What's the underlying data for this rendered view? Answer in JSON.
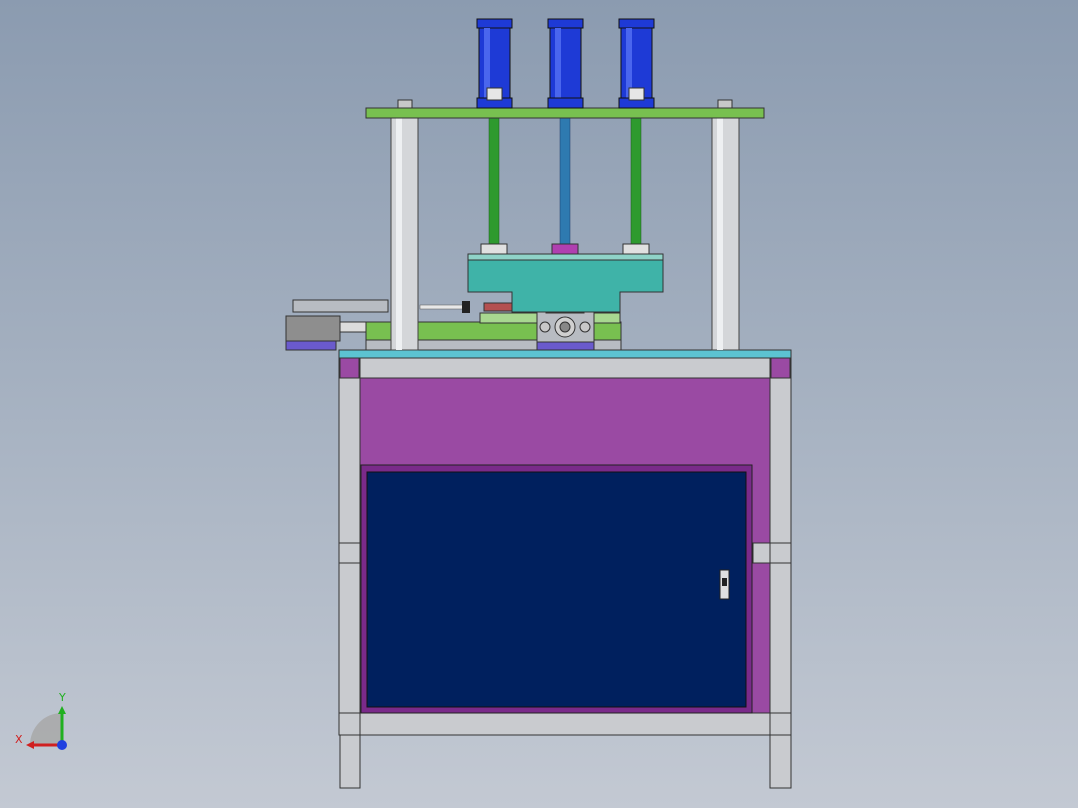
{
  "viewport": {
    "background_top": "#8b9bb0",
    "background_bottom": "#c3c9d3"
  },
  "model": {
    "colors": {
      "cabinet_purple": "#9a4aa3",
      "door_navy": "#00205e",
      "door_frame": "#7a2a8a",
      "frame_gray": "#c9cbcf",
      "column_gray": "#d4d6d9",
      "plate_green": "#78c050",
      "rod_green": "#2e9a2e",
      "cylinder_blue": "#1e3ad6",
      "slide_teal": "#3fb3a8",
      "base_plate_cyan": "#5cc3d1",
      "fixture_gray": "#b8bcc2",
      "actuator_purple": "#6a5acd"
    },
    "cylinder_count": 3
  },
  "triad": {
    "x_label": "X",
    "y_label": "Y",
    "x_color": "#d02020",
    "y_color": "#20b020",
    "z_color": "#2040e0"
  }
}
